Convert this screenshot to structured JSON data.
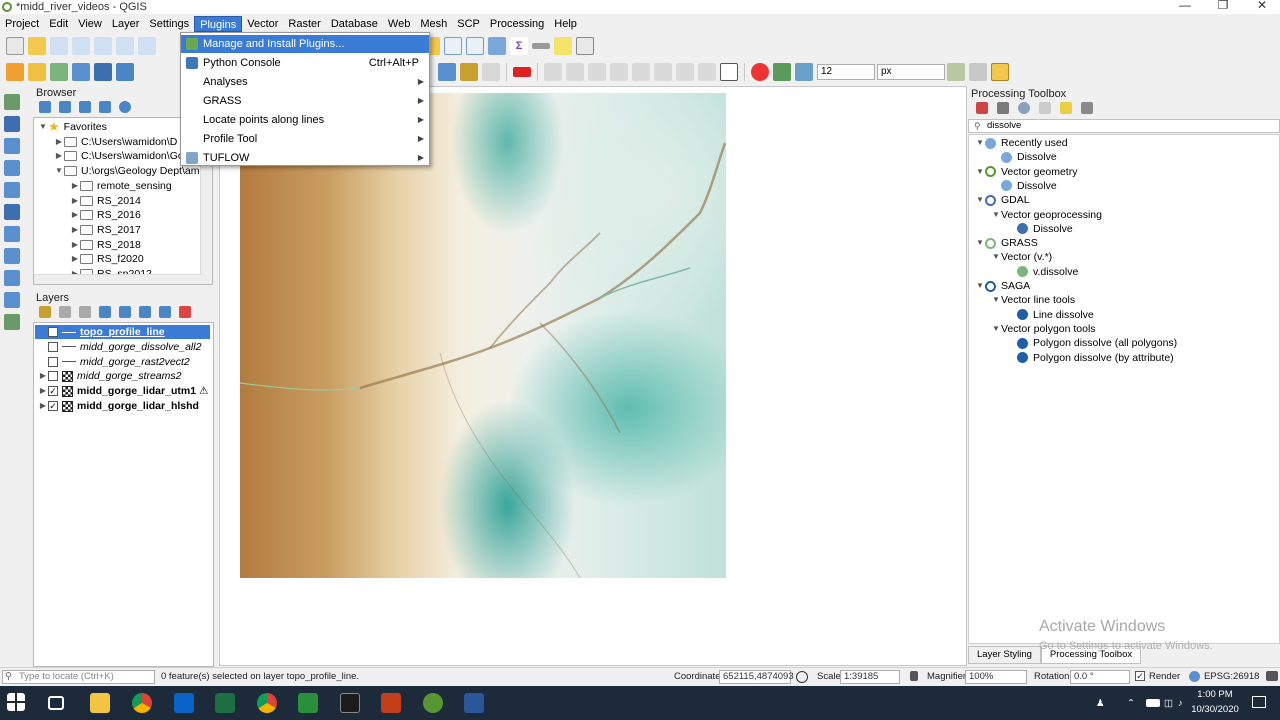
{
  "window": {
    "title": "*midd_river_videos - QGIS"
  },
  "menubar": [
    "Project",
    "Edit",
    "View",
    "Layer",
    "Settings",
    "Plugins",
    "Vector",
    "Raster",
    "Database",
    "Web",
    "Mesh",
    "SCP",
    "Processing",
    "Help"
  ],
  "plugins_menu": {
    "items": [
      {
        "label": "Manage and Install Plugins...",
        "shortcut": "",
        "submenu": false,
        "icon": "plugin-icon"
      },
      {
        "label": "Python Console",
        "shortcut": "Ctrl+Alt+P",
        "submenu": false,
        "icon": "python-icon"
      },
      {
        "label": "Analyses",
        "shortcut": "",
        "submenu": true,
        "icon": ""
      },
      {
        "label": "GRASS",
        "shortcut": "",
        "submenu": true,
        "icon": ""
      },
      {
        "label": "Locate points along lines",
        "shortcut": "",
        "submenu": true,
        "icon": ""
      },
      {
        "label": "Profile Tool",
        "shortcut": "",
        "submenu": true,
        "icon": ""
      },
      {
        "label": "TUFLOW",
        "shortcut": "",
        "submenu": true,
        "icon": "tuflow-icon"
      }
    ]
  },
  "toolbar": {
    "snap_tolerance": "12",
    "snap_unit": "px"
  },
  "browser": {
    "title": "Browser",
    "items": [
      {
        "label": "Favorites",
        "indent": 0,
        "expanded": true,
        "icon": "star-icon"
      },
      {
        "label": "C:\\Users\\wamidon\\D",
        "indent": 1,
        "expanded": false,
        "icon": "folder-icon"
      },
      {
        "label": "C:\\Users\\wamidon\\Go",
        "indent": 1,
        "expanded": false,
        "icon": "folder-icon"
      },
      {
        "label": "U:\\orgs\\Geology Dept\\am",
        "indent": 1,
        "expanded": true,
        "icon": "folder-icon"
      },
      {
        "label": "remote_sensing",
        "indent": 2,
        "expanded": false,
        "icon": "folder-icon"
      },
      {
        "label": "RS_2014",
        "indent": 2,
        "expanded": false,
        "icon": "folder-icon"
      },
      {
        "label": "RS_2016",
        "indent": 2,
        "expanded": false,
        "icon": "folder-icon"
      },
      {
        "label": "RS_2017",
        "indent": 2,
        "expanded": false,
        "icon": "folder-icon"
      },
      {
        "label": "RS_2018",
        "indent": 2,
        "expanded": false,
        "icon": "folder-icon"
      },
      {
        "label": "RS_f2020",
        "indent": 2,
        "expanded": false,
        "icon": "folder-icon"
      },
      {
        "label": "RS_sp2012",
        "indent": 2,
        "expanded": false,
        "icon": "folder-icon"
      }
    ]
  },
  "layers": {
    "title": "Layers",
    "items": [
      {
        "label": "topo_profile_line",
        "checked": true,
        "selected": true,
        "style": "bold",
        "expand": false,
        "icon": "line-icon"
      },
      {
        "label": "midd_gorge_dissolve_all2",
        "checked": false,
        "selected": false,
        "style": "italic",
        "expand": false,
        "icon": "line-icon"
      },
      {
        "label": "midd_gorge_rast2vect2",
        "checked": false,
        "selected": false,
        "style": "italic",
        "expand": false,
        "icon": "line-icon"
      },
      {
        "label": "midd_gorge_streams2",
        "checked": false,
        "selected": false,
        "style": "italic",
        "expand": true,
        "icon": "raster-icon"
      },
      {
        "label": "midd_gorge_lidar_utm1",
        "checked": true,
        "selected": false,
        "style": "bold",
        "expand": true,
        "icon": "raster-icon"
      },
      {
        "label": "midd_gorge_lidar_hlshd",
        "checked": true,
        "selected": false,
        "style": "bold",
        "expand": true,
        "icon": "raster-icon"
      }
    ]
  },
  "processing": {
    "title": "Processing Toolbox",
    "search": "dissolve",
    "tree": [
      {
        "label": "Recently used",
        "indent": 0,
        "expand": true,
        "icon": "clock-icon"
      },
      {
        "label": "Dissolve",
        "indent": 1,
        "expand": false,
        "icon": "algorithm-icon"
      },
      {
        "label": "Vector geometry",
        "indent": 0,
        "expand": true,
        "icon": "qgis-icon"
      },
      {
        "label": "Dissolve",
        "indent": 1,
        "expand": false,
        "icon": "algorithm-icon"
      },
      {
        "label": "GDAL",
        "indent": 0,
        "expand": true,
        "icon": "gdal-icon"
      },
      {
        "label": "Vector geoprocessing",
        "indent": 1,
        "expand": true,
        "icon": ""
      },
      {
        "label": "Dissolve",
        "indent": 2,
        "expand": false,
        "icon": "gdal-algorithm-icon"
      },
      {
        "label": "GRASS",
        "indent": 0,
        "expand": true,
        "icon": "grass-icon"
      },
      {
        "label": "Vector (v.*)",
        "indent": 1,
        "expand": true,
        "icon": ""
      },
      {
        "label": "v.dissolve",
        "indent": 2,
        "expand": false,
        "icon": "grass-algorithm-icon"
      },
      {
        "label": "SAGA",
        "indent": 0,
        "expand": true,
        "icon": "saga-icon"
      },
      {
        "label": "Vector line tools",
        "indent": 1,
        "expand": true,
        "icon": ""
      },
      {
        "label": "Line dissolve",
        "indent": 2,
        "expand": false,
        "icon": "saga-algorithm-icon"
      },
      {
        "label": "Vector polygon tools",
        "indent": 1,
        "expand": true,
        "icon": ""
      },
      {
        "label": "Polygon dissolve (all polygons)",
        "indent": 2,
        "expand": false,
        "icon": "saga-algorithm-icon"
      },
      {
        "label": "Polygon dissolve (by attribute)",
        "indent": 2,
        "expand": false,
        "icon": "saga-algorithm-icon"
      }
    ],
    "tabs": [
      "Layer Styling",
      "Processing Toolbox"
    ]
  },
  "watermark": {
    "title": "Activate Windows",
    "subtitle": "Go to Settings to activate Windows."
  },
  "statusbar": {
    "locate_placeholder": "Type to locate (Ctrl+K)",
    "message": "0 feature(s) selected on layer topo_profile_line.",
    "coordinate_label": "Coordinate",
    "coordinate": "652115,4874093",
    "scale_label": "Scale",
    "scale": "1:39185",
    "magnifier_label": "Magnifier",
    "magnifier": "100%",
    "rotation_label": "Rotation",
    "rotation": "0.0 °",
    "render_label": "Render",
    "crs": "EPSG:26918"
  },
  "taskbar": {
    "time": "1:00 PM",
    "date": "10/30/2020"
  }
}
